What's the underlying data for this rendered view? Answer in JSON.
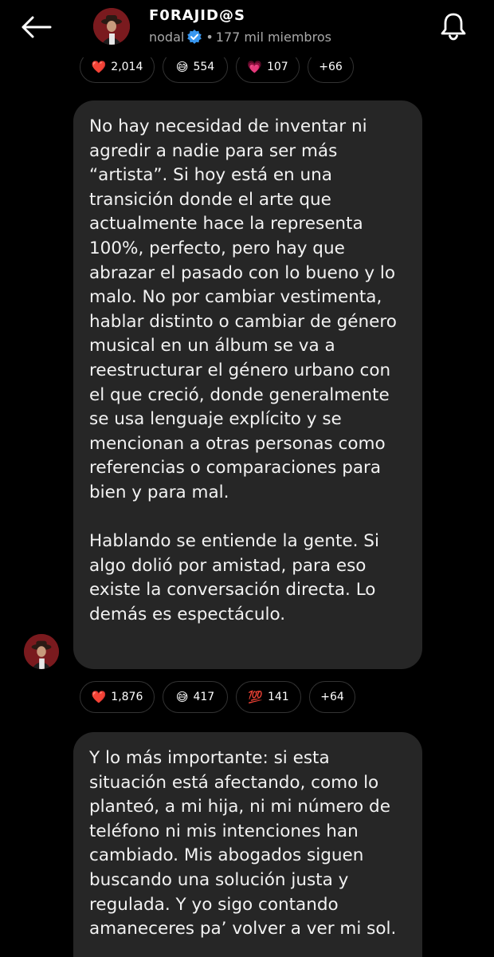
{
  "header": {
    "title": "F0RAJID@S",
    "creator": "nodal",
    "separator": "•",
    "members": "177 mil miembros"
  },
  "reactions_top": [
    {
      "emoji": "❤️",
      "count": "2,014",
      "icon": "heart-icon"
    },
    {
      "emoji": "😅",
      "count": "554",
      "icon": "sweat-smile-icon"
    },
    {
      "emoji": "💗",
      "count": "107",
      "icon": "growing-heart-icon"
    },
    {
      "more": "+66"
    }
  ],
  "message1": {
    "paragraphs": [
      "No hay necesidad de inventar ni agredir a nadie para ser más “artista”. Si hoy está en una transición donde el arte que actualmente hace la representa 100%, perfecto, pero hay que abrazar el pasado con lo bueno y lo malo. No por cambiar vestimenta, hablar distinto o cambiar de género musical en un álbum se va a reestructurar el género urbano con el que creció, donde generalmente se usa lenguaje explícito y se mencionan a otras personas como referencias o comparaciones para bien y para mal.",
      "Hablando se entiende la gente. Si algo dolió por amistad, para eso existe la conversación directa. Lo demás es espectáculo."
    ]
  },
  "reactions_mid": [
    {
      "emoji": "❤️",
      "count": "1,876",
      "icon": "heart-icon"
    },
    {
      "emoji": "😅",
      "count": "417",
      "icon": "sweat-smile-icon"
    },
    {
      "emoji": "💯",
      "count": "141",
      "icon": "hundred-points-icon"
    },
    {
      "more": "+64"
    }
  ],
  "message2": {
    "text": "Y lo más importante: si esta situación está afectando, como lo planteó, a mi hija, ni mi número de teléfono ni mis intenciones han cambiado. Mis abogados siguen buscando una solución justa y regulada. Y yo sigo contando amaneceres pa’ volver a ver mi sol."
  },
  "colors": {
    "background": "#000000",
    "bubble": "#262626",
    "verified": "#3897f0",
    "secondary_text": "#a8a8a8"
  }
}
